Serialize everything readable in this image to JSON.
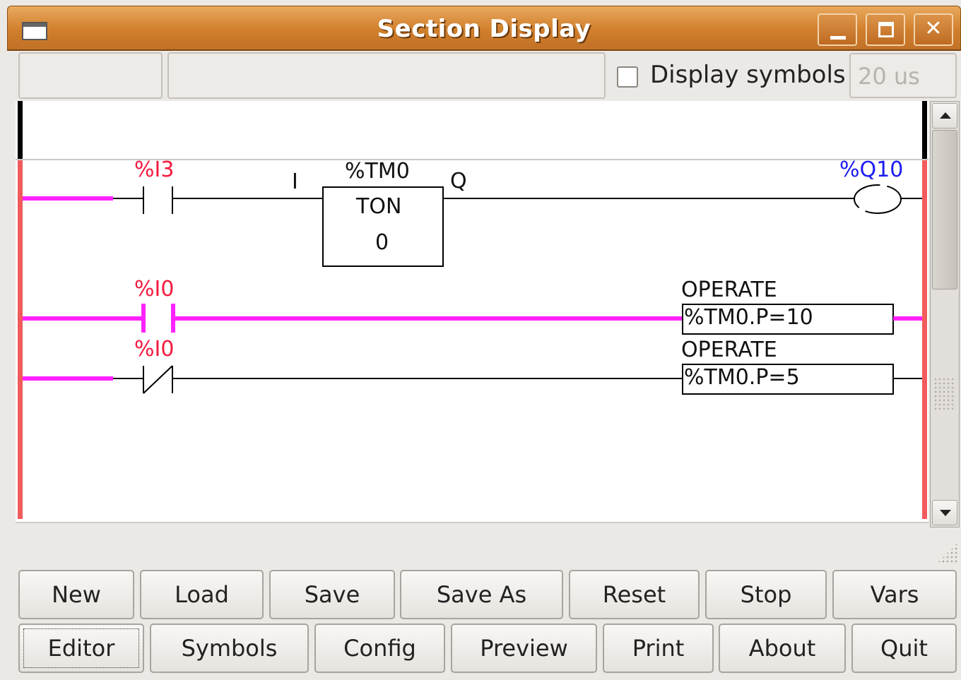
{
  "window": {
    "title": "Section Display"
  },
  "status": {
    "display_symbols_label": "Display symbols",
    "display_symbols_checked": false,
    "cycle_time": "20 us"
  },
  "ladder": {
    "rung1": {
      "contact_label": "%I3",
      "input_label": "I",
      "timer_name": "%TM0",
      "timer_type": "TON",
      "timer_value": "0",
      "output_label": "Q",
      "coil_label": "%Q10"
    },
    "rung2": {
      "contact_label": "%I0",
      "operate_label": "OPERATE",
      "operate_expr": "%TM0.P=10"
    },
    "rung3": {
      "contact_label": "%I0",
      "operate_label": "OPERATE",
      "operate_expr": "%TM0.P=5"
    }
  },
  "buttons": {
    "row1": [
      "New",
      "Load",
      "Save",
      "Save As",
      "Reset",
      "Stop",
      "Vars"
    ],
    "row2": [
      "Editor",
      "Symbols",
      "Config",
      "Preview",
      "Print",
      "About",
      "Quit"
    ]
  },
  "colors": {
    "active_wire": "#ff22ff",
    "rail": "#f25b5b",
    "contact_label": "#f21b3f",
    "coil_label": "#1b1bf2"
  }
}
